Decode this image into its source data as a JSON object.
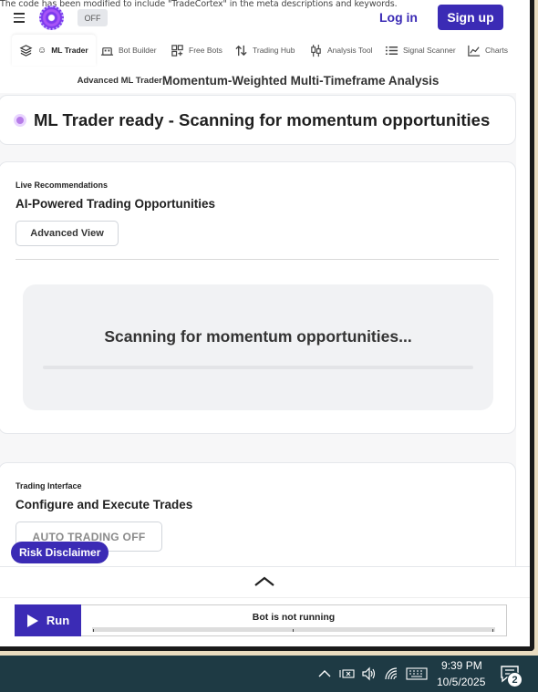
{
  "notice": "The code has been modified to include \"TradeCortex\" in the meta descriptions and keywords.",
  "header": {
    "toggle_label": "OFF",
    "login_label": "Log in",
    "signup_label": "Sign up"
  },
  "nav": {
    "items": [
      {
        "label": "ML Trader",
        "icon": "layers-icon",
        "active": true
      },
      {
        "label": "Bot Builder",
        "icon": "robot-icon"
      },
      {
        "label": "Free Bots",
        "icon": "grid-plus-icon"
      },
      {
        "label": "Trading Hub",
        "icon": "arrows-up-down-icon"
      },
      {
        "label": "Analysis Tool",
        "icon": "candlestick-icon"
      },
      {
        "label": "Signal Scanner",
        "icon": "list-icon"
      },
      {
        "label": "Charts",
        "icon": "line-chart-icon"
      }
    ]
  },
  "subtitle": {
    "small": "Advanced ML Trader",
    "large": "Momentum-Weighted Multi-Timeframe Analysis"
  },
  "status": {
    "text": "ML Trader ready - Scanning for momentum opportunities"
  },
  "recommendations": {
    "tag": "Live Recommendations",
    "title": "AI-Powered Trading Opportunities",
    "button_label": "Advanced View",
    "scanning_text": "Scanning for momentum opportunities..."
  },
  "trading": {
    "tag": "Trading Interface",
    "title": "Configure and Execute Trades",
    "auto_label": "AUTO TRADING OFF"
  },
  "risk_label": "Risk Disclaimer",
  "bottom": {
    "run_label": "Run",
    "bot_status": "Bot is not running"
  },
  "taskbar": {
    "time": "9:39 PM",
    "date": "10/5/2025",
    "notification_count": "2"
  },
  "colors": {
    "accent": "#3b2bb5",
    "status_dot": "#b67ce8",
    "taskbar": "#1e3a44",
    "desktop": "#e9dcc0"
  }
}
